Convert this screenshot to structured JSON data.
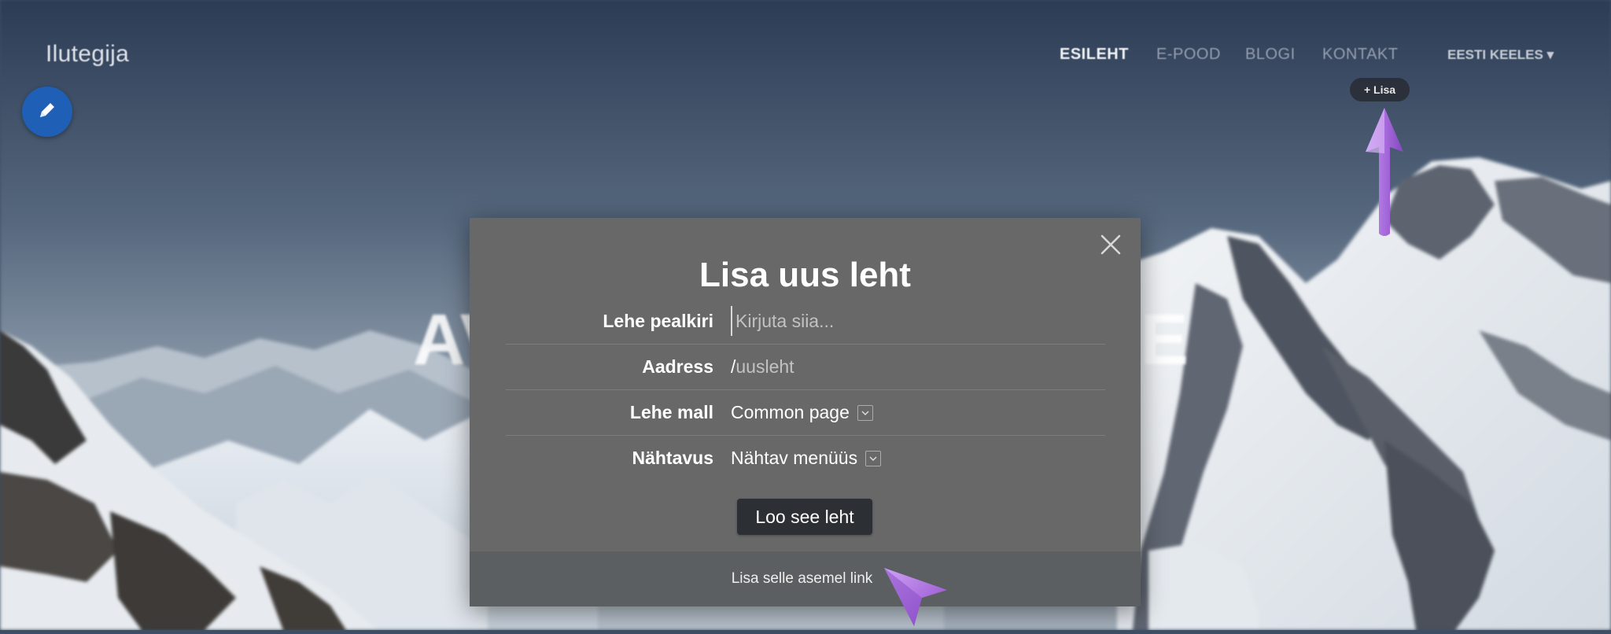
{
  "site": {
    "title": "Ilutegija"
  },
  "nav": {
    "items": [
      {
        "label": "ESILEHT",
        "active": true
      },
      {
        "label": "E-POOD",
        "active": false
      },
      {
        "label": "BLOGI",
        "active": false
      },
      {
        "label": "KONTAKT",
        "active": false
      }
    ],
    "language": "EESTI KEELES ▾",
    "add_label": "+ Lisa"
  },
  "hero": {
    "text_left": "AV",
    "text_right": "GE"
  },
  "modal": {
    "title": "Lisa uus leht",
    "fields": {
      "title_label": "Lehe pealkiri",
      "title_placeholder": "Kirjuta siia...",
      "title_value": "",
      "address_label": "Aadress",
      "address_prefix": "/",
      "address_slug": "uusleht",
      "template_label": "Lehe mall",
      "template_value": "Common page",
      "visibility_label": "Nähtavus",
      "visibility_value": "Nähtav menüüs"
    },
    "submit_label": "Loo see leht",
    "footer_link": "Lisa selle asemel link"
  },
  "colors": {
    "modal_bg": "#686868",
    "footer_bg": "#5c5f61",
    "button_bg": "#2c2f33",
    "edit_button": "#1f5fb5",
    "annotation_arrow": "#a86cdc"
  },
  "icons": {
    "edit": "pencil-icon",
    "close": "close-icon",
    "dropdown": "chevron-down-icon",
    "annotation_up": "arrow-up-icon",
    "annotation_cursor": "cursor-arrow-icon"
  }
}
